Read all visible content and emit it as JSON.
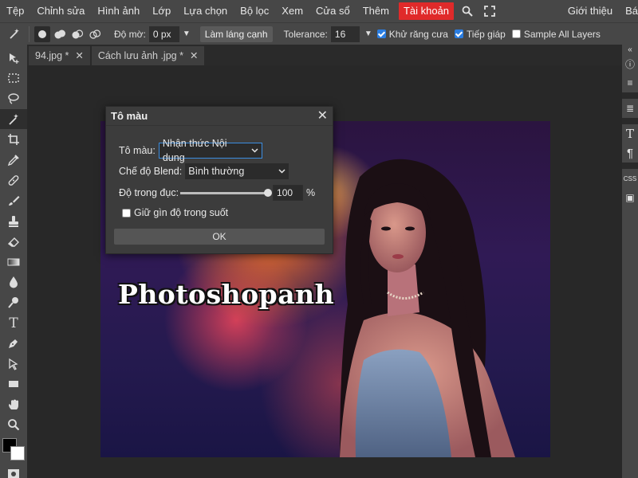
{
  "menu": {
    "items": [
      "Tệp",
      "Chỉnh sửa",
      "Hình ảnh",
      "Lớp",
      "Lựa chọn",
      "Bộ lọc",
      "Xem",
      "Cửa sổ",
      "Thêm"
    ],
    "account": "Tài khoản",
    "right": [
      "Giới thiệu",
      "Bá"
    ]
  },
  "options": {
    "feather_label": "Độ mờ:",
    "feather_value": "0 px",
    "smooth_button": "Làm láng cạnh",
    "tolerance_label": "Tolerance:",
    "tolerance_value": "16",
    "antialias_label": "Khử răng cưa",
    "contiguous_label": "Tiếp giáp",
    "sample_all_label": "Sample All Layers",
    "antialias_checked": true,
    "contiguous_checked": true,
    "sample_all_checked": false
  },
  "tabs": [
    {
      "label": "94.jpg *",
      "close": "✕"
    },
    {
      "label": "Cách lưu ảnh .jpg *",
      "close": "✕"
    }
  ],
  "canvas": {
    "overlay_text": "Photoshopanh"
  },
  "dialog": {
    "title": "Tô màu",
    "close": "✕",
    "fill_label": "Tô màu:",
    "fill_value": "Nhận thức Nội dung",
    "blend_label": "Chế độ Blend:",
    "blend_value": "Bình thường",
    "opacity_label": "Độ trong đục:",
    "opacity_value": "100",
    "opacity_unit": "%",
    "opacity_fraction": 1.0,
    "preserve_label": "Giữ gìn độ trong suốt",
    "preserve_checked": false,
    "ok_label": "OK"
  },
  "right_panel": [
    "«",
    "ⓘ",
    "≡",
    "≣",
    "T",
    "¶",
    "CSS",
    "▣"
  ],
  "colors": {
    "accent": "#2a7de1",
    "account_bg": "#e02a2a",
    "chrome": "#474747",
    "workspace": "#282828"
  }
}
